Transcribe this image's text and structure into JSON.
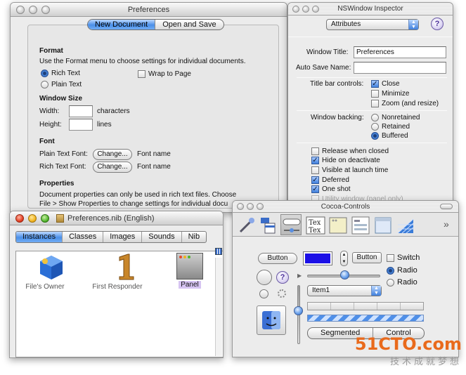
{
  "preferences": {
    "title": "Preferences",
    "tabs": [
      "New Document",
      "Open and Save"
    ],
    "format": {
      "heading": "Format",
      "desc": "Use the Format menu to choose settings for individual documents.",
      "rich_text": "Rich Text",
      "plain_text": "Plain Text",
      "wrap_to_page": "Wrap to Page"
    },
    "window_size": {
      "heading": "Window Size",
      "width_label": "Width:",
      "width_unit": "characters",
      "height_label": "Height:",
      "height_unit": "lines"
    },
    "font": {
      "heading": "Font",
      "plain_label": "Plain Text Font:",
      "rich_label": "Rich Text Font:",
      "change": "Change...",
      "font_name": "Font name"
    },
    "properties": {
      "heading": "Properties",
      "line1": "Document properties can only be used in rich text files. Choose",
      "line2": "File > Show Properties to change settings for individual docu"
    }
  },
  "inspector": {
    "title": "NSWindow Inspector",
    "popup": "Attributes",
    "help": "?",
    "window_title_label": "Window Title:",
    "window_title_value": "Preferences",
    "autosave_label": "Auto Save Name:",
    "autosave_value": "",
    "titlebar_label": "Title bar controls:",
    "close": "Close",
    "minimize": "Minimize",
    "zoom": "Zoom (and resize)",
    "backing_label": "Window backing:",
    "nonretained": "Nonretained",
    "retained": "Retained",
    "buffered": "Buffered",
    "release_when_closed": "Release when closed",
    "hide_on_deactivate": "Hide on deactivate",
    "visible_at_launch": "Visible at launch time",
    "deferred": "Deferred",
    "one_shot": "One shot",
    "utility_window": "Utility window (panel only)"
  },
  "nib": {
    "title": "Preferences.nib (English)",
    "tabs": [
      "Instances",
      "Classes",
      "Images",
      "Sounds",
      "Nib"
    ],
    "items": [
      "File's Owner",
      "First Responder",
      "Panel"
    ]
  },
  "palette": {
    "title": "Cocoa-Controls",
    "overflow": "»",
    "button": "Button",
    "button2": "Button",
    "switch": "Switch",
    "radio1": "Radio",
    "radio2": "Radio",
    "help": "?",
    "item1": "Item1",
    "segmented": "Segmented",
    "control": "Control"
  },
  "watermark": {
    "logo": "51CTO.com",
    "sub": "技术成就梦想"
  },
  "colors": {
    "accent_blue": "#4a8fe8",
    "color_well": "#1c10e6",
    "watermark": "#e96a1c"
  }
}
